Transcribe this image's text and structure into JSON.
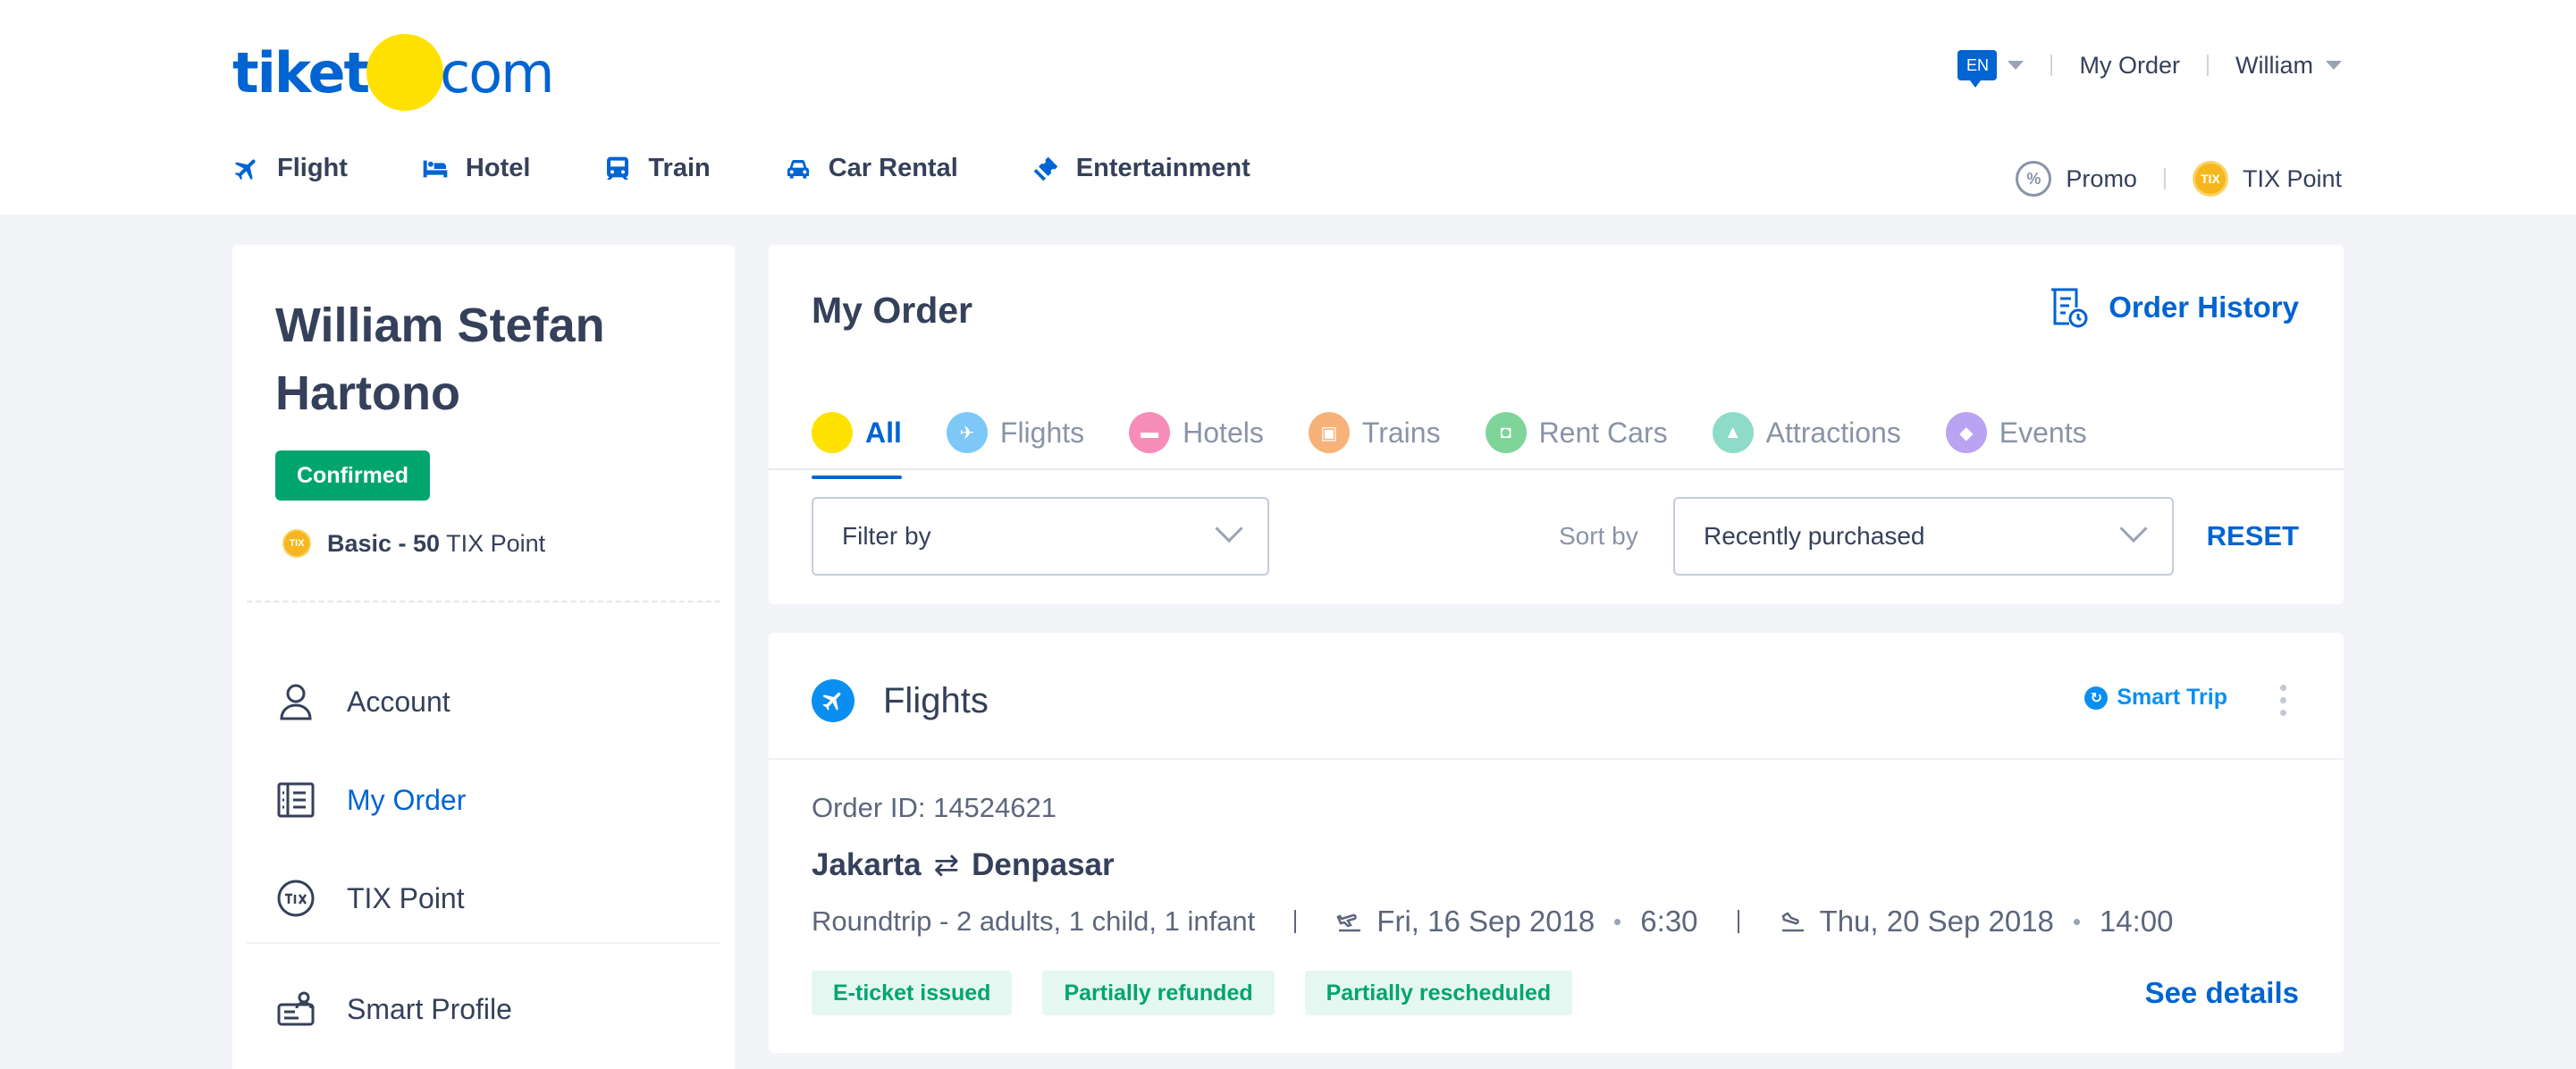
{
  "header": {
    "logo": {
      "left": "tiket",
      "right": "com"
    },
    "lang": "EN",
    "my_order": "My Order",
    "user": "William",
    "nav": [
      {
        "label": "Flight",
        "icon": "plane-icon"
      },
      {
        "label": "Hotel",
        "icon": "bed-icon"
      },
      {
        "label": "Train",
        "icon": "train-icon"
      },
      {
        "label": "Car Rental",
        "icon": "car-icon"
      },
      {
        "label": "Entertainment",
        "icon": "ticket-icon"
      }
    ],
    "promo": "Promo",
    "promo_glyph": "%",
    "tix_point": "TIX Point",
    "coin_glyph": "TIX"
  },
  "sidebar": {
    "name": "William Stefan Hartono",
    "status": "Confirmed",
    "tier_bold": "Basic - 50",
    "tier_rest": "TIX Point",
    "menu": [
      {
        "label": "Account",
        "icon": "user-icon"
      },
      {
        "label": "My Order",
        "icon": "order-list-icon"
      },
      {
        "label": "TIX Point",
        "icon": "tix-icon"
      }
    ],
    "smart_profile": "Smart Profile",
    "tix_glyph": "TIX"
  },
  "order": {
    "title": "My Order",
    "history": "Order History",
    "tabs": [
      {
        "label": "All",
        "color": "#ffe100"
      },
      {
        "label": "Flights",
        "color": "#7ec8f7"
      },
      {
        "label": "Hotels",
        "color": "#f58db8"
      },
      {
        "label": "Trains",
        "color": "#f7b27a"
      },
      {
        "label": "Rent Cars",
        "color": "#7fd49a"
      },
      {
        "label": "Attractions",
        "color": "#8edcc8"
      },
      {
        "label": "Events",
        "color": "#b9a3f2"
      }
    ],
    "filter": "Filter by",
    "sort_label": "Sort by",
    "sort_value": "Recently purchased",
    "reset": "RESET"
  },
  "flight": {
    "section": "Flights",
    "smart_trip": "Smart Trip",
    "order_id": "Order ID: 14524621",
    "from": "Jakarta",
    "swap": "⇄",
    "to": "Denpasar",
    "trip": "Roundtrip - 2 adults, 1 child, 1 infant",
    "depart_date": "Fri, 16 Sep 2018",
    "depart_time": "6:30",
    "return_date": "Thu, 20 Sep 2018",
    "return_time": "14:00",
    "tags": [
      "E-ticket issued",
      "Partially refunded",
      "Partially rescheduled"
    ],
    "see_details": "See details"
  },
  "colors": {
    "brand": "#0064d2",
    "success": "#00a56e",
    "yellow": "#ffe100"
  }
}
